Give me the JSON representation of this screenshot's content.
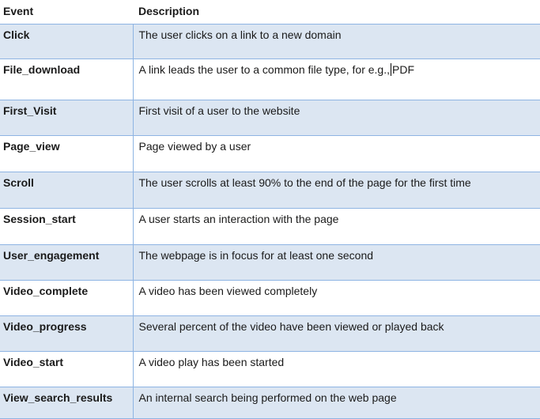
{
  "headers": {
    "event": "Event",
    "description": "Description"
  },
  "rows": [
    {
      "event": "Click",
      "description": "The user clicks on a link to a new domain"
    },
    {
      "event": "File_download",
      "description_before_cursor": "A link leads the user to a common file type, for e.g.,",
      "description_after_cursor": "PDF"
    },
    {
      "event": "First_Visit",
      "description": "First visit of a user to the website"
    },
    {
      "event": "Page_view",
      "description": "Page viewed by a user"
    },
    {
      "event": "Scroll",
      "description": "The user scrolls at least 90% to the end of the page for the first time"
    },
    {
      "event": "Session_start",
      "description": "A user starts an interaction with the page"
    },
    {
      "event": "User_engagement",
      "description": "The webpage is in focus for at least one second"
    },
    {
      "event": "Video_complete",
      "description": "A video has been viewed completely"
    },
    {
      "event": "Video_progress",
      "description": "Several percent of the video have been viewed or played back"
    },
    {
      "event": "Video_start",
      "description": "A video play has been started"
    },
    {
      "event": "View_search_results",
      "description": "An internal search being performed on the web page"
    }
  ],
  "colors": {
    "shaded_row": "#dce6f2",
    "border": "#8eb4e3"
  }
}
